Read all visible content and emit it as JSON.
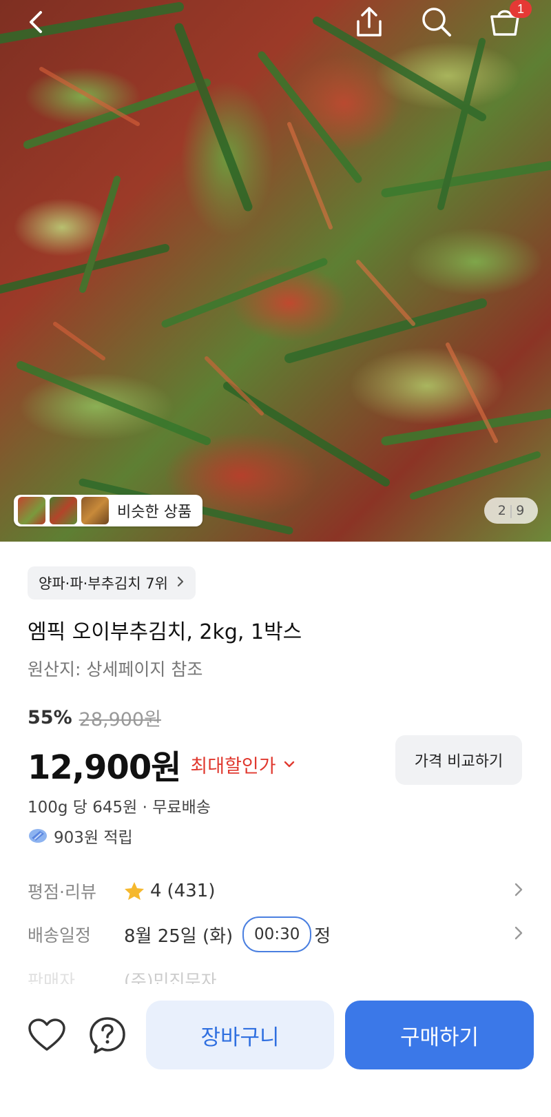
{
  "header": {
    "cart_count": "1"
  },
  "hero": {
    "similar_label": "비슷한 상품",
    "counter_current": "2",
    "counter_total": "9"
  },
  "product": {
    "category": "양파·파·부추김치 7위",
    "title": "엠픽 오이부추김치, 2kg, 1박스",
    "origin": "원산지: 상세페이지 참조",
    "discount_percent": "55%",
    "original_price": "28,900원",
    "price": "12,900원",
    "max_discount_label": "최대할인가",
    "compare_button": "가격 비교하기",
    "unit_price": "100g 당 645원 · 무료배송",
    "points": "903원 적립"
  },
  "info": {
    "rating_label": "평점·리뷰",
    "rating_value": "4",
    "review_count": "(431)",
    "delivery_label": "배송일정",
    "delivery_date": "8월 25일 (화)",
    "delivery_time": "00:30",
    "delivery_suffix": "정",
    "seller_label": "판매자",
    "seller_value": "(주)민진무자"
  },
  "bottom": {
    "cart_button": "장바구니",
    "buy_button": "구매하기"
  },
  "colors": {
    "accent": "#3b78e8",
    "discount_red": "#e0392f",
    "star": "#f5b82e",
    "badge": "#e53935"
  }
}
